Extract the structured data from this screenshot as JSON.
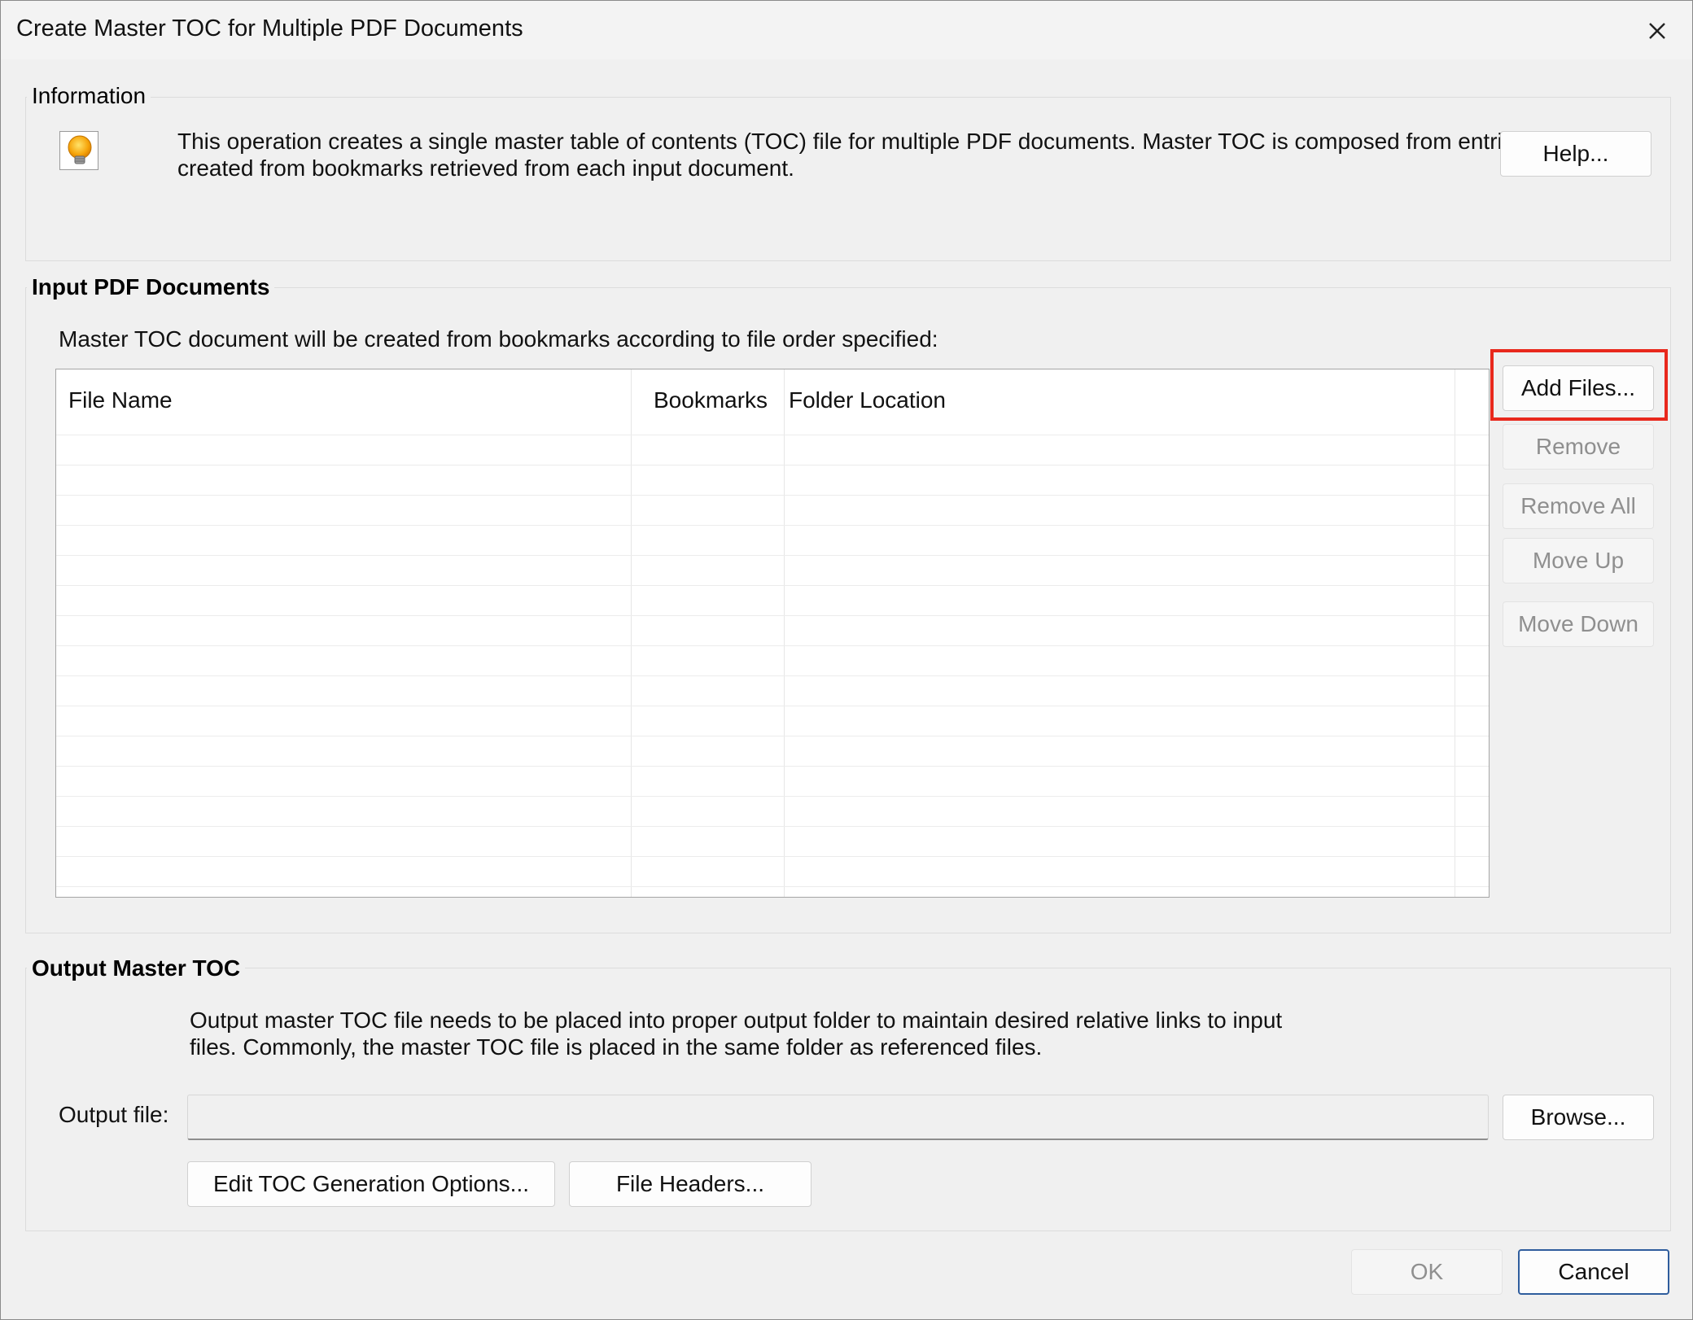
{
  "window": {
    "title": "Create Master TOC for Multiple PDF Documents"
  },
  "information": {
    "heading": "Information",
    "line1": "This operation creates a single master table of contents (TOC) file for multiple PDF documents. Master TOC is composed from entries",
    "line2": "created from bookmarks retrieved from each input document.",
    "help_label": "Help..."
  },
  "input_docs": {
    "heading": "Input PDF Documents",
    "instruction": "Master TOC document will be created from bookmarks according to file order specified:",
    "columns": [
      "File Name",
      "Bookmarks",
      "Folder Location"
    ],
    "buttons": {
      "add_files": "Add Files...",
      "remove": "Remove",
      "remove_all": "Remove All",
      "move_up": "Move Up",
      "move_down": "Move Down"
    }
  },
  "output": {
    "heading": "Output Master TOC",
    "line1": "Output master TOC file needs to be placed into proper output folder to maintain desired relative links to input",
    "line2": "files. Commonly, the master TOC file is placed in the same folder as referenced files.",
    "output_file_label": "Output file:",
    "output_file_value": "",
    "browse_label": "Browse...",
    "edit_options_label": "Edit TOC Generation Options...",
    "file_headers_label": "File Headers..."
  },
  "footer": {
    "ok_label": "OK",
    "cancel_label": "Cancel"
  },
  "colors": {
    "highlight": "#e8281c",
    "default_button_border": "#2f5d9d"
  },
  "icons": {
    "info": "lightbulb-icon",
    "close": "close-icon"
  }
}
